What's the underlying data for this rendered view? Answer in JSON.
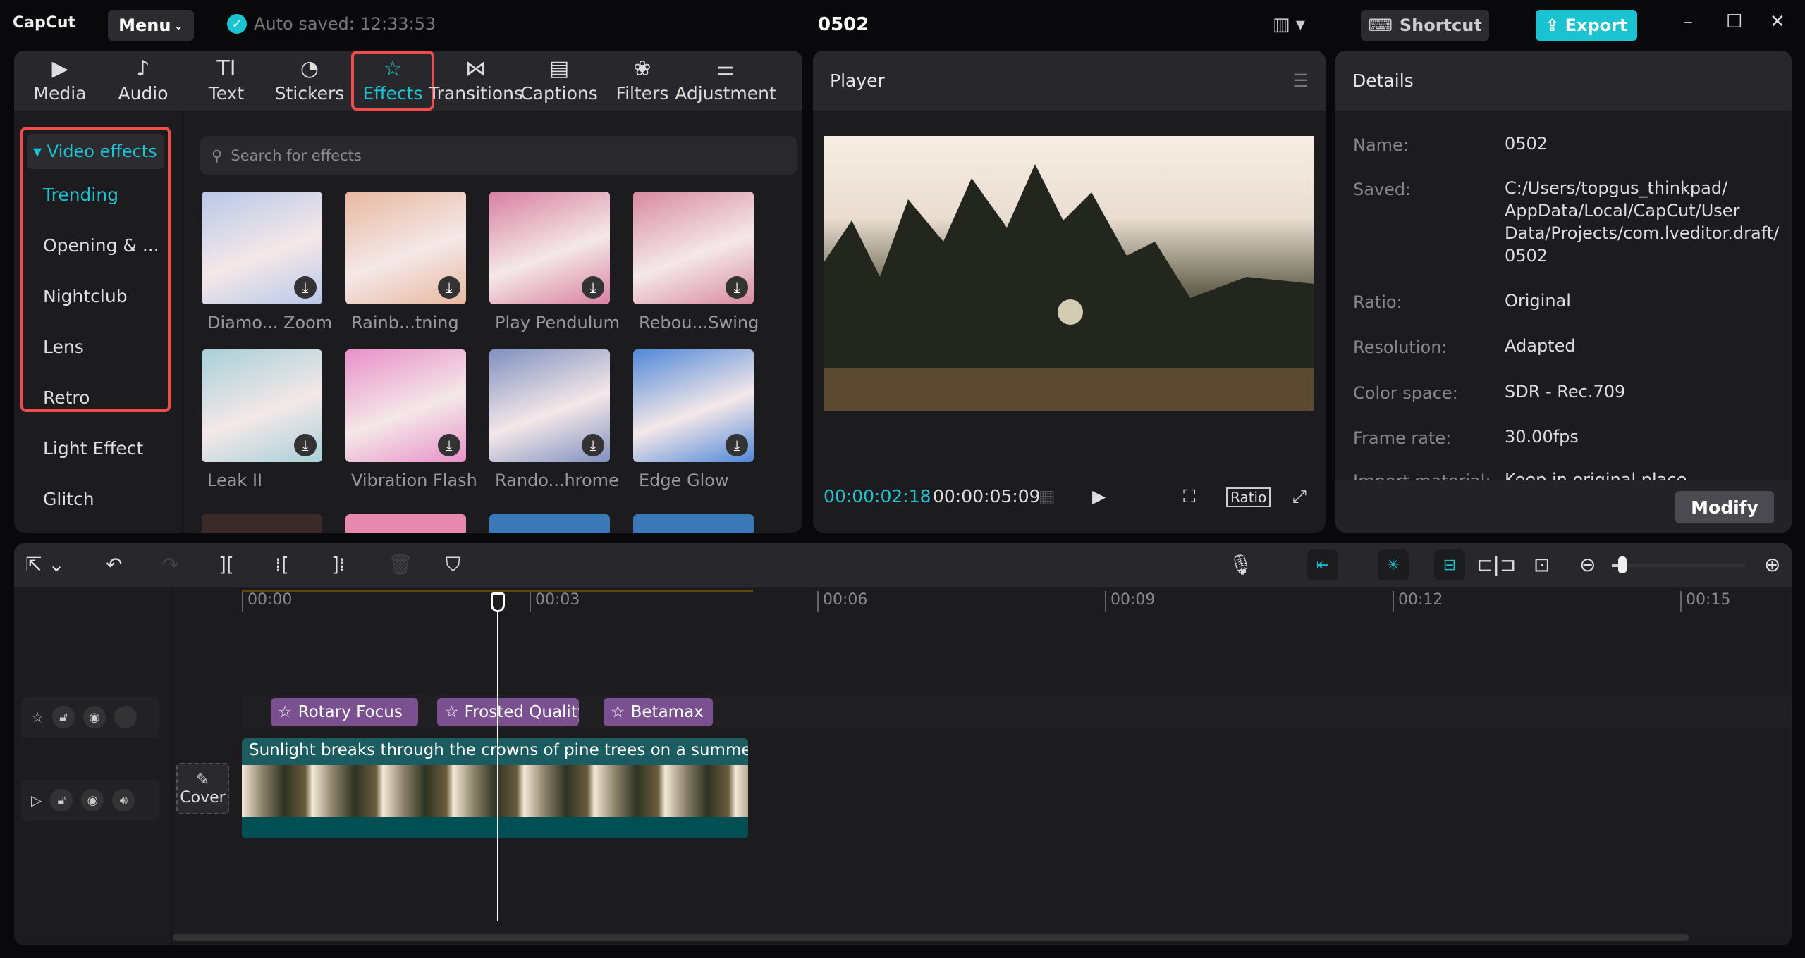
{
  "app": {
    "logo": "CapCut",
    "menu": "Menu",
    "autosave": "Auto saved: 12:33:53",
    "title": "0502",
    "shortcut": "Shortcut",
    "export": "Export"
  },
  "tabs": [
    {
      "label": "Media",
      "icon": "▶"
    },
    {
      "label": "Audio",
      "icon": "♪"
    },
    {
      "label": "Text",
      "icon": "TI"
    },
    {
      "label": "Stickers",
      "icon": "◔"
    },
    {
      "label": "Effects",
      "icon": "☆"
    },
    {
      "label": "Transitions",
      "icon": "⋈"
    },
    {
      "label": "Captions",
      "icon": "▤"
    },
    {
      "label": "Filters",
      "icon": "❀"
    },
    {
      "label": "Adjustment",
      "icon": "⚌"
    }
  ],
  "categories": {
    "header": "▾ Video effects",
    "items": [
      "Trending",
      "Opening & ...",
      "Nightclub",
      "Lens",
      "Retro",
      "Light Effect",
      "Glitch"
    ]
  },
  "search": {
    "placeholder": "Search for effects"
  },
  "effects": [
    {
      "label": "Diamo... Zoom",
      "color": "#b9c8e8"
    },
    {
      "label": "Rainb...tning",
      "color": "#e8b8a0"
    },
    {
      "label": "Play Pendulum",
      "color": "#d880a0"
    },
    {
      "label": "Rebou...Swing",
      "color": "#d88aa0"
    },
    {
      "label": "Leak II",
      "color": "#a8d0d8"
    },
    {
      "label": "Vibration Flash",
      "color": "#e890c8"
    },
    {
      "label": "Rando...hrome",
      "color": "#8090c0"
    },
    {
      "label": "Edge Glow",
      "color": "#5088d8"
    }
  ],
  "player": {
    "title": "Player",
    "current": "00:00:02:18",
    "total": "00:00:05:09",
    "ratio": "Ratio"
  },
  "details": {
    "title": "Details",
    "rows": [
      {
        "k": "Name:",
        "v": "0502"
      },
      {
        "k": "Saved:",
        "v": "C:/Users/topgus_thinkpad/ AppData/Local/CapCut/User Data/Projects/com.lveditor.draft/ 0502"
      },
      {
        "k": "Ratio:",
        "v": "Original"
      },
      {
        "k": "Resolution:",
        "v": "Adapted"
      },
      {
        "k": "Color space:",
        "v": "SDR - Rec.709"
      },
      {
        "k": "Frame rate:",
        "v": "30.00fps"
      },
      {
        "k": "Import material:",
        "v": "Keep in original place"
      }
    ],
    "modify": "Modify"
  },
  "timeline": {
    "ruler": [
      "00:00",
      "00:03",
      "00:06",
      "00:09",
      "00:12",
      "00:15"
    ],
    "fx": [
      "Rotary Focus",
      "Frosted Quality",
      "Betamax"
    ],
    "caption": "Sunlight breaks through the crowns of pine trees on a summer sunrise",
    "cover": "Cover",
    "zoom_level": 0.08
  }
}
